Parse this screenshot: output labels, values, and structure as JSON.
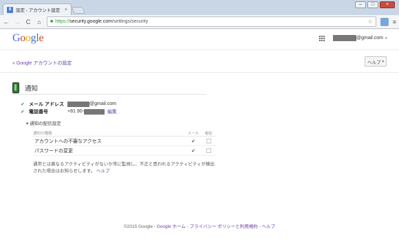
{
  "browser": {
    "tab_title": "設定 - アカウント設定",
    "tab_close": "×",
    "favicon_letter": "8",
    "window_controls": {
      "minimize": "–",
      "maximize": "□",
      "close": "×"
    },
    "nav": {
      "back": "←",
      "forward": "→",
      "reload": "C",
      "home": "⌂"
    },
    "url": {
      "scheme": "https://",
      "host": "security.google.com",
      "path": "/settings/security"
    },
    "star": "☆",
    "menu": "≡"
  },
  "header": {
    "logo": {
      "g1": "G",
      "o1": "o",
      "o2": "o",
      "g2": "g",
      "l": "l",
      "e": "e"
    },
    "account_email_suffix": "@gmail.com",
    "account_caret": "▾"
  },
  "subbar": {
    "back_link": "« Google アカウントの設定",
    "help_button": "ヘルプ",
    "help_caret": "▾"
  },
  "notifications": {
    "title": "通知",
    "rows": [
      {
        "check": "✔",
        "label": "メール アドレス",
        "value_suffix": "@gmail.com"
      },
      {
        "check": "✔",
        "label": "電話番号",
        "value_prefix": "+81 90-",
        "edit": "編集"
      }
    ],
    "settings_toggle": "▾ 通知の配信設定",
    "table": {
      "headers": {
        "type": "通知の種類",
        "email": "メール",
        "phone": "電話"
      },
      "rows": [
        {
          "type": "アカウントへの不審なアクセス",
          "email": "✔"
        },
        {
          "type": "パスワードの変更",
          "email": "✔"
        }
      ]
    },
    "description": "通常とは異なるアクティビティがないか常に監視し、不正と思われるアクティビティが検出された場合はお知らせします。",
    "description_link": "ヘルプ"
  },
  "footer": {
    "copyright": "©2015 Google - ",
    "home": "Google ホーム",
    "sep1": " - ",
    "privacy": "プライバシー ポリシーと利用規約",
    "sep2": " - ",
    "help": "ヘルプ"
  }
}
